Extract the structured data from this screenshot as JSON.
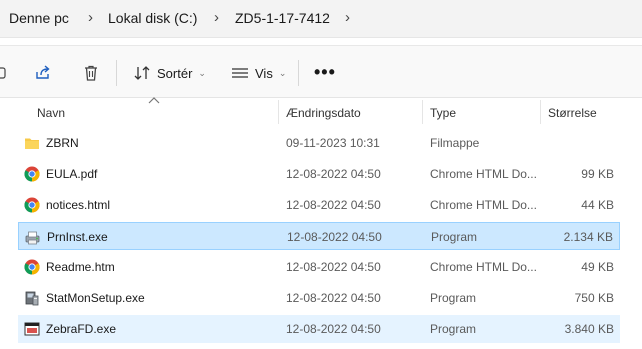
{
  "breadcrumb": [
    "Denne pc",
    "Lokal disk (C:)",
    "ZD5-1-17-7412"
  ],
  "toolbar": {
    "sort_label": "Sortér",
    "view_label": "Vis",
    "more_label": "•••"
  },
  "columns": {
    "name": "Navn",
    "date": "Ændringsdato",
    "type": "Type",
    "size": "Størrelse"
  },
  "files": [
    {
      "name": "ZBRN",
      "date": "09-11-2023 10:31",
      "type": "Filmappe",
      "size": "",
      "icon": "folder-icon"
    },
    {
      "name": "EULA.pdf",
      "date": "12-08-2022 04:50",
      "type": "Chrome HTML Do...",
      "size": "99 KB",
      "icon": "chrome-icon"
    },
    {
      "name": "notices.html",
      "date": "12-08-2022 04:50",
      "type": "Chrome HTML Do...",
      "size": "44 KB",
      "icon": "chrome-icon"
    },
    {
      "name": "PrnInst.exe",
      "date": "12-08-2022 04:50",
      "type": "Program",
      "size": "2.134 KB",
      "icon": "printer-setup-icon"
    },
    {
      "name": "Readme.htm",
      "date": "12-08-2022 04:50",
      "type": "Chrome HTML Do...",
      "size": "49 KB",
      "icon": "chrome-icon"
    },
    {
      "name": "StatMonSetup.exe",
      "date": "12-08-2022 04:50",
      "type": "Program",
      "size": "750 KB",
      "icon": "installer-icon"
    },
    {
      "name": "ZebraFD.exe",
      "date": "12-08-2022 04:50",
      "type": "Program",
      "size": "3.840 KB",
      "icon": "app-window-icon"
    }
  ],
  "colors": {
    "selected_bg": "#cce8ff",
    "selected_border": "#99d1ff",
    "hover_bg": "#e5f3ff",
    "folder": "#f7c948"
  }
}
